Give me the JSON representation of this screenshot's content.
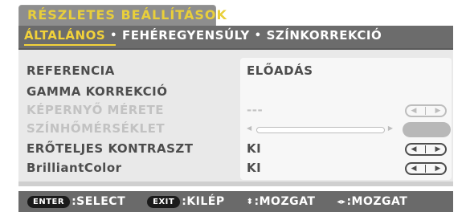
{
  "title": "RÉSZLETES BEÁLLÍTÁSOK",
  "tabs": {
    "active": "ÁLTALÁNOS",
    "sep1": "•",
    "t2": "FEHÉREGYENSÚLY",
    "sep2": "•",
    "t3": "SZÍNKORREKCIÓ"
  },
  "settings": [
    {
      "label": "REFERENCIA",
      "value": "ELŐADÁS",
      "enabled": true
    },
    {
      "label": "GAMMA KORREKCIÓ",
      "value": "",
      "enabled": true
    },
    {
      "label": "KÉPERNYŐ MÉRETE",
      "value": "---",
      "enabled": false
    },
    {
      "label": "SZÍNHŐMÉRSÉKLET",
      "value": "",
      "enabled": false
    },
    {
      "label": "ERŐTELJES KONTRASZT",
      "value": "KI",
      "enabled": true
    },
    {
      "label": "BrilliantColor",
      "value": "KI",
      "enabled": true
    }
  ],
  "footer": {
    "enter_key": "ENTER",
    "enter_text": ":SELECT",
    "exit_key": "EXIT",
    "exit_text": ":KILÉP",
    "updown_glyph": "⬍",
    "updown_text": ":MOZGAT",
    "leftright_glyph": "◂▸",
    "leftright_text": ":MOZGAT"
  },
  "colors": {
    "title": "#e9cf3a",
    "active_tab": "#f2d23a",
    "panel": "#e9e9e9",
    "bars": "#6c6c6c"
  }
}
